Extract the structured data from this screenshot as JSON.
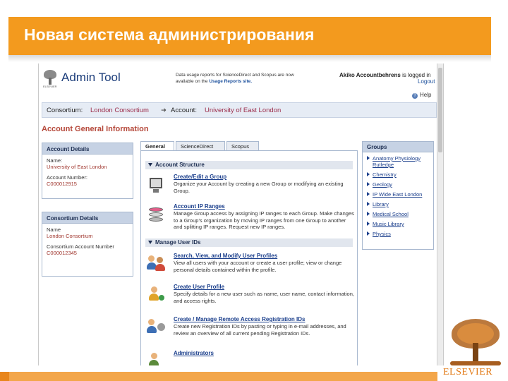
{
  "slide": {
    "title": "Новая система администрирования",
    "logo_text": "ELSEVIER"
  },
  "header": {
    "logo_caption": "ELSEVIER",
    "app_name": "Admin Tool",
    "notice_line1": "Data usage reports for ScienceDirect and Scopus are now",
    "notice_prefix": "available on the",
    "notice_link": "Usage Reports site.",
    "user_name": "Akiko Accountbehrens",
    "user_tail": "is logged in",
    "logout": "Logout",
    "help": "Help"
  },
  "breadcrumb": {
    "consortium_label": "Consortium:",
    "consortium_value": "London Consortium",
    "arrow": "➜",
    "account_label": "Account:",
    "account_value": "University of East London"
  },
  "section_title": "Account General Information",
  "account_details": {
    "heading": "Account Details",
    "name_label": "Name:",
    "name_value": "University of East London",
    "number_label": "Account Number:",
    "number_value": "C000012915"
  },
  "consortium_details": {
    "heading": "Consortium Details",
    "name_label": "Name",
    "name_value": "London Consortium",
    "number_label": "Consortium Account Number",
    "number_value": "C000012345"
  },
  "tabs": [
    {
      "label": "General"
    },
    {
      "label": "ScienceDirect"
    },
    {
      "label": "Scopus"
    }
  ],
  "account_structure": {
    "heading": "Account Structure",
    "items": [
      {
        "title": "Create/Edit a Group",
        "desc": "Organize your Account by creating a new Group or modifying an existing Group."
      },
      {
        "title": "Account IP Ranges",
        "desc": "Manage Group access by assigning IP ranges to each Group. Make changes to a Group's organization by moving IP ranges from one Group to another and splitting IP ranges. Request new IP ranges."
      }
    ]
  },
  "manage_users": {
    "heading": "Manage User IDs",
    "items": [
      {
        "title": "Search, View, and Modify User Profiles",
        "desc": "View all users with your account or create a user profile; view or change personal details contained within the profile."
      },
      {
        "title": "Create User Profile",
        "desc": "Specify details for a new user such as name, user name, contact information, and access rights."
      },
      {
        "title": "Create / Manage Remote Access Registration IDs",
        "desc": "Create new Registration IDs by pasting or typing in e-mail addresses, and review an overview of all current pending Registration IDs."
      },
      {
        "title": "Administrators",
        "desc": ""
      }
    ]
  },
  "groups": {
    "heading": "Groups",
    "items": [
      "Anatomy Physiology Rutledge",
      "Chemistry",
      "Geology",
      "IP Wide East London",
      "Library",
      "Medical School",
      "Music Library",
      "Physics"
    ]
  },
  "colors": {
    "title_bar": "#f39a1e",
    "link_blue": "#1b3f8c",
    "value_red": "#a0372f",
    "panel_head": "#c6d2e4",
    "elsevier_orange": "#e27a16"
  }
}
